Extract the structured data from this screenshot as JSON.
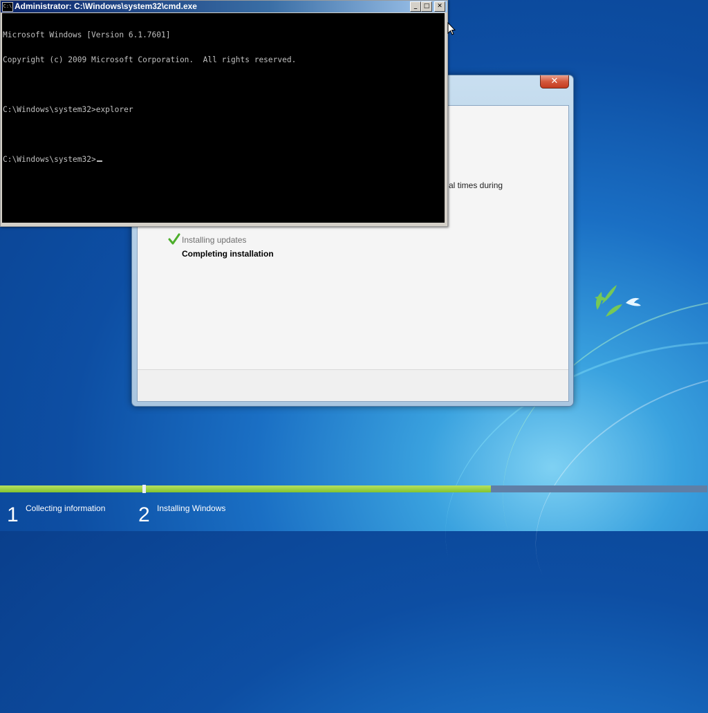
{
  "cmd": {
    "title": "Administrator: C:\\Windows\\system32\\cmd.exe",
    "icon_text": "C:\\",
    "lines": [
      "Microsoft Windows [Version 6.1.7601]",
      "Copyright (c) 2009 Microsoft Corporation.  All rights reserved.",
      "",
      "C:\\Windows\\system32>explorer",
      "",
      "C:\\Windows\\system32>"
    ],
    "controls": {
      "minimize": "_",
      "maximize": "□",
      "close": "✕"
    }
  },
  "setup_window": {
    "close_symbol": "✕",
    "partial_text": "al times during",
    "steps": [
      {
        "label": "Installing updates",
        "state": "done"
      },
      {
        "label": "Completing installation",
        "state": "current"
      }
    ]
  },
  "progress": {
    "stage1": {
      "number": "1",
      "label": "Collecting information",
      "fraction": 1.0
    },
    "stage2": {
      "number": "2",
      "label": "Installing Windows",
      "fraction": 0.615
    }
  },
  "colors": {
    "progress_fill": "#8cc63f",
    "progress_track": "#5f7fa6"
  }
}
